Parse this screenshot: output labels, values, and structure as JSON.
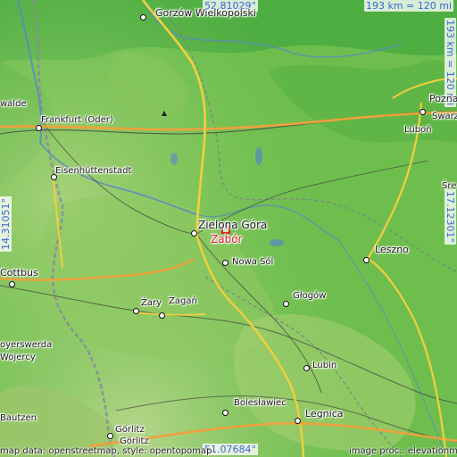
{
  "map": {
    "coords": {
      "top": "52.81029°",
      "bottom": "51.07684°",
      "left": "14.31051°",
      "right": "17.12301°",
      "scale_h": "193 km = 120 mi",
      "scale_v": "193 km = 120 mi"
    },
    "place": "Zabór",
    "cities": [
      {
        "id": "gorzow",
        "name": "Gorzów Wielkopolski"
      },
      {
        "id": "poznan",
        "name": "Poznań"
      },
      {
        "id": "swarzedz",
        "name": "Swarzę"
      },
      {
        "id": "lubon",
        "name": "Luboń"
      },
      {
        "id": "frankfurt",
        "name": "Frankfurt (Oder)"
      },
      {
        "id": "walde",
        "name": "walde"
      },
      {
        "id": "eisen",
        "name": "Eisenhüttenstadt"
      },
      {
        "id": "zielona",
        "name": "Zielona Góra"
      },
      {
        "id": "leszno",
        "name": "Leszno"
      },
      {
        "id": "nowasol",
        "name": "Nowa Sól"
      },
      {
        "id": "cottbus",
        "name": "Cottbus"
      },
      {
        "id": "zary",
        "name": "Żary"
      },
      {
        "id": "zagan",
        "name": "Żagań"
      },
      {
        "id": "glogow",
        "name": "Głogów"
      },
      {
        "id": "hoyerswerda",
        "name": "oyerswerda"
      },
      {
        "id": "wojercy",
        "name": "Wojercy"
      },
      {
        "id": "lubin",
        "name": "Lubin"
      },
      {
        "id": "boleslawiec",
        "name": "Bolesławiec"
      },
      {
        "id": "legnica",
        "name": "Legnica"
      },
      {
        "id": "bautzen",
        "name": "Bautzen"
      },
      {
        "id": "gorlitz1",
        "name": "Görlitz"
      },
      {
        "id": "gorlitz2",
        "name": "Görlitz"
      },
      {
        "id": "srem",
        "name": "Śre"
      }
    ],
    "credit_left": "map data: openstreetmap, style: opentopomap",
    "credit_right": "image proc.: elevationmap"
  }
}
